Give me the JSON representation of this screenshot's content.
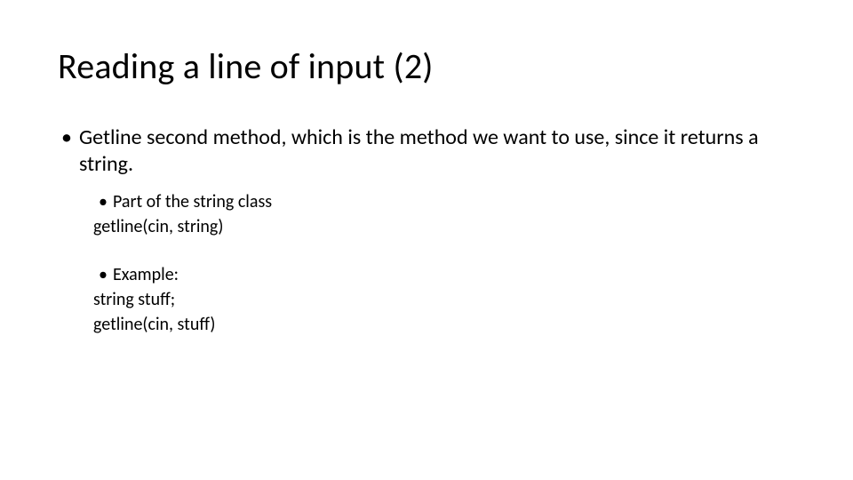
{
  "title": "Reading a line of input (2)",
  "bullet1": "Getline second method, which is the method we want to use, since it returns a string.",
  "sub1_a": "Part of the string class",
  "sub1_b": "getline(cin, string)",
  "sub2_a": "Example:",
  "sub2_b": "string stuff;",
  "sub2_c": "getline(cin, stuff)"
}
